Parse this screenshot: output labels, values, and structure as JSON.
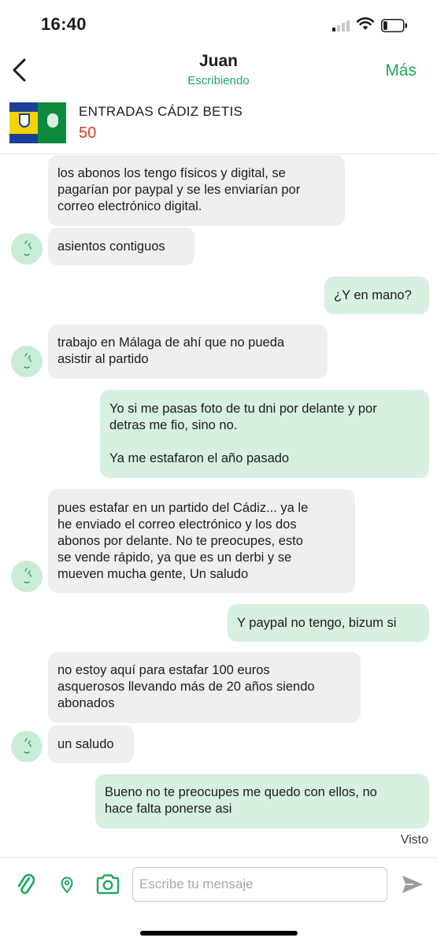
{
  "status_bar": {
    "time": "16:40",
    "signal_bars_on": 1,
    "signal_bars_total": 4,
    "battery_level": 0.2
  },
  "header": {
    "back_icon": "chevron-left-icon",
    "name": "Juan",
    "status": "Escribiendo",
    "more_label": "Más"
  },
  "item": {
    "title": "ENTRADAS CÁDIZ BETIS",
    "price": "50"
  },
  "messages": [
    {
      "direction": "in",
      "lines": [
        "los abonos los tengo físicos y digital, se",
        "pagarían por paypal y se les enviarían por",
        "correo electrónico digital."
      ]
    },
    {
      "direction": "in",
      "lines": [
        "asientos contiguos"
      ]
    },
    {
      "direction": "out",
      "lines": [
        "¿Y en mano?"
      ]
    },
    {
      "direction": "in",
      "lines": [
        "trabajo en Málaga de ahí que no pueda",
        "asistir al partido"
      ]
    },
    {
      "direction": "out",
      "lines": [
        "Yo si me pasas foto de tu dni por delante y por",
        "detras me fio, sino no.",
        "",
        "Ya me estafaron el año pasado"
      ]
    },
    {
      "direction": "in",
      "lines": [
        "pues estafar en un partido del Cádiz... ya le",
        "he enviado el correo electrónico y los dos",
        "abonos por delante. No te preocupes, esto",
        "se vende rápido, ya que es un derbi y se",
        "mueven mucha gente, Un saludo"
      ]
    },
    {
      "direction": "out",
      "lines": [
        "Y paypal no tengo, bizum si"
      ]
    },
    {
      "direction": "in",
      "lines": [
        "no estoy aquí para estafar 100 euros",
        "asquerosos llevando más de 20 años siendo",
        "abonados"
      ]
    },
    {
      "direction": "in",
      "lines": [
        "un saludo"
      ]
    },
    {
      "direction": "out",
      "lines": [
        "Bueno no te preocupes me quedo con ellos, no",
        "hace falta ponerse asi"
      ]
    }
  ],
  "seen_label": "Visto",
  "composer": {
    "placeholder": "Escribe tu mensaje",
    "value": "",
    "icons": [
      "paperclip-icon",
      "location-pin-icon",
      "camera-icon",
      "send-icon"
    ]
  },
  "colors": {
    "accent": "#1fa85f",
    "price": "#d93a2b",
    "incoming_bubble": "#efefef",
    "outgoing_bubble": "#d7f0e0",
    "avatar": "#c9ecd6"
  }
}
